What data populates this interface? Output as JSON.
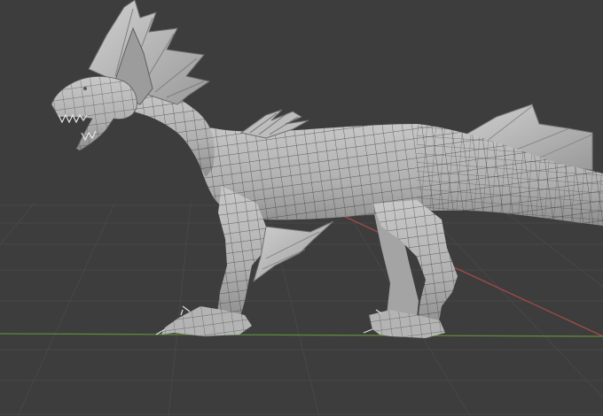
{
  "app": {
    "name": "",
    "view": "3D Viewport"
  },
  "viewport": {
    "background_color": "#3d3d3d",
    "grid_color": "#4a4a4a",
    "x_axis_color": "#a34a4a",
    "y_axis_color": "#5d8a3a",
    "grid_visible": true
  },
  "scene": {
    "object": "dragon",
    "shading": "solid",
    "wireframe_overlay": true,
    "mesh_color": "#b8b8b8",
    "wire_color": "#2a2a2a"
  }
}
